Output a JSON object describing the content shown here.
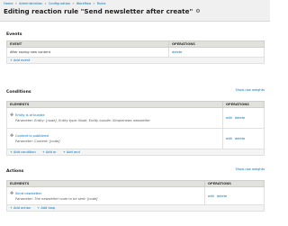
{
  "breadcrumb": [
    "Home",
    "Administration",
    "Configuration",
    "Workflow",
    "Rules"
  ],
  "page_title": "Editing reaction rule \"Send newsletter after create\"",
  "events": {
    "title": "Events",
    "col_event": "EVENT",
    "col_operations": "OPERATIONS",
    "rows": [
      {
        "name": "After saving new content",
        "delete": "delete"
      }
    ],
    "add_label": "Add event"
  },
  "conditions": {
    "title": "Conditions",
    "show_row_weights": "Show row weights",
    "col_elements": "ELEMENTS",
    "col_operations": "OPERATIONS",
    "rows": [
      {
        "name": "Entity is of bundle",
        "param": "Parameter: Entity: [node], Entity type: Node, Entity bundle: Simplenews newsletter",
        "edit": "edit",
        "delete": "delete"
      },
      {
        "name": "Content is published",
        "param": "Parameter: Content: [node]",
        "edit": "edit",
        "delete": "delete"
      }
    ],
    "add_condition": "Add condition",
    "add_or": "Add or",
    "add_and": "Add and"
  },
  "actions": {
    "title": "Actions",
    "show_row_weights": "Show row weights",
    "col_elements": "ELEMENTS",
    "col_operations": "OPERATIONS",
    "rows": [
      {
        "name": "Send newsletter",
        "param": "Parameter: The newsletter node to be sent: [node]",
        "edit": "edit",
        "delete": "delete"
      }
    ],
    "add_action": "Add action",
    "add_loop": "Add loop"
  }
}
